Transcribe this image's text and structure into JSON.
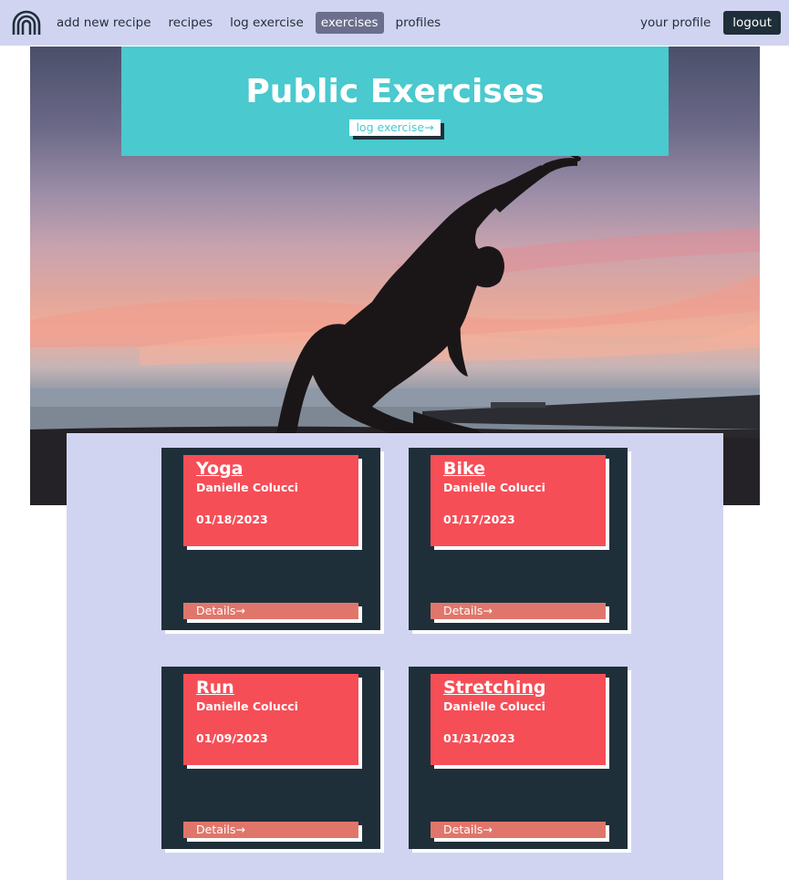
{
  "nav": {
    "logo_icon": "rainbow-arch-icon",
    "links": [
      {
        "label": "add new recipe",
        "active": false
      },
      {
        "label": "recipes",
        "active": false
      },
      {
        "label": "log exercise",
        "active": false
      },
      {
        "label": "exercises",
        "active": true
      },
      {
        "label": "profiles",
        "active": false
      }
    ],
    "profile_label": "your profile",
    "logout_label": "logout"
  },
  "hero": {
    "title": "Public Exercises",
    "button_label": "log exercise→",
    "image": "yoga-pose-silhouette-at-sunset-photo"
  },
  "exercises": [
    {
      "title": "Yoga",
      "author": "Danielle Colucci",
      "date": "01/18/2023",
      "details_label": "Details→"
    },
    {
      "title": "Bike",
      "author": "Danielle Colucci",
      "date": "01/17/2023",
      "details_label": "Details→"
    },
    {
      "title": "Run",
      "author": "Danielle Colucci",
      "date": "01/09/2023",
      "details_label": "Details→"
    },
    {
      "title": "Stretching",
      "author": "Danielle Colucci",
      "date": "01/31/2023",
      "details_label": "Details→"
    }
  ],
  "colors": {
    "nav_bg": "#d1d4f1",
    "banner": "#4ac9ce",
    "card_bg": "#1f2f3a",
    "card_head": "#f64e57",
    "details_bg": "#e0766b",
    "active_link": "#6b6e8c"
  }
}
